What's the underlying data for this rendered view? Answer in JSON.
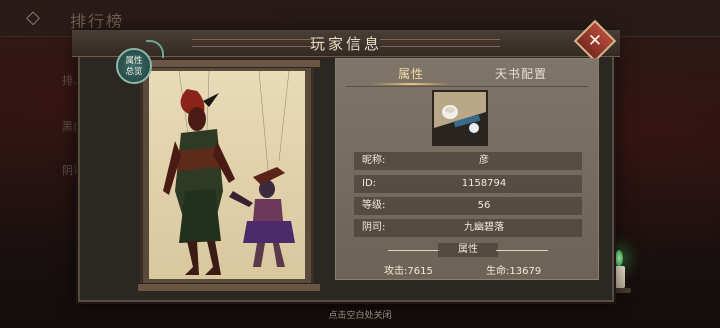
{
  "background": {
    "title": "排行榜",
    "side_items": [
      "排…",
      "黑白…",
      "阴司…"
    ]
  },
  "dialog": {
    "title": "玩家信息",
    "close_label": "✕",
    "overview_badge": "属性总览",
    "tabs": [
      {
        "label": "属性",
        "active": true
      },
      {
        "label": "天书配置",
        "active": false
      }
    ],
    "info": [
      {
        "label": "昵称:",
        "value": "彦"
      },
      {
        "label": "ID:",
        "value": "1158794"
      },
      {
        "label": "等级:",
        "value": "56"
      },
      {
        "label": "阴司:",
        "value": "九幽碧落"
      }
    ],
    "attr_section_label": "属性",
    "attack": "攻击:7615",
    "hp": "生命:13679"
  },
  "footer_hint": "点击空白处关闭",
  "colors": {
    "accent_gold": "#e7c07c",
    "close_red": "#b34a3a",
    "candle_green": "#5ad06a"
  }
}
